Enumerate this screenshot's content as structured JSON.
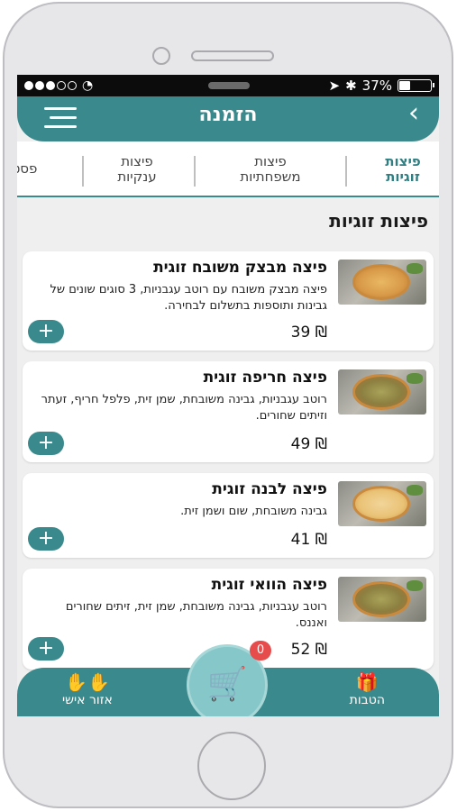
{
  "status_bar": {
    "battery_text": "37%",
    "battery_level": 0.37,
    "signal_dots": 5,
    "signal_filled": 3
  },
  "header": {
    "title": "הזמנה",
    "back_icon": "chevron-right-icon",
    "menu_icon": "hamburger-menu-icon"
  },
  "categories": [
    {
      "line1": "פיצות",
      "line2": "זוגיות",
      "active": true
    },
    {
      "line1": "פיצות",
      "line2": "משפחתיות",
      "active": false
    },
    {
      "line1": "פיצות",
      "line2": "ענקיות",
      "active": false
    },
    {
      "line1": "פסט",
      "line2": "",
      "active": false
    }
  ],
  "section_title": "פיצות זוגיות",
  "products": [
    {
      "name": "פיצה מבצק משובח זוגית",
      "description": "פיצה מבצק משובח עם רוטב עגבניות, 3 סוגים שונים של גבינות ותוספות בתשלום לבחירה.",
      "price": "39 ₪",
      "add_label": "+"
    },
    {
      "name": "פיצה חריפה זוגית",
      "description": "רוטב עגבניות, גבינה משובחת, שמן זית, פלפל חריף, זעתר וזיתים שחורים.",
      "price": "49 ₪",
      "add_label": "+"
    },
    {
      "name": "פיצה לבנה זוגית",
      "description": "גבינה משובחת, שום ושמן זית.",
      "price": "41 ₪",
      "add_label": "+"
    },
    {
      "name": "פיצה הוואי זוגית",
      "description": "רוטב עגבניות, גבינה משובחת, שמן זית, זיתים שחורים ואננס.",
      "price": "52 ₪",
      "add_label": "+"
    }
  ],
  "bottom_nav": {
    "right_label": "הטבות",
    "left_label": "אזור אישי",
    "cart_count": "0"
  },
  "colors": {
    "accent": "#3a8a8d",
    "cart": "#86c7c9",
    "badge": "#e74c4c"
  }
}
